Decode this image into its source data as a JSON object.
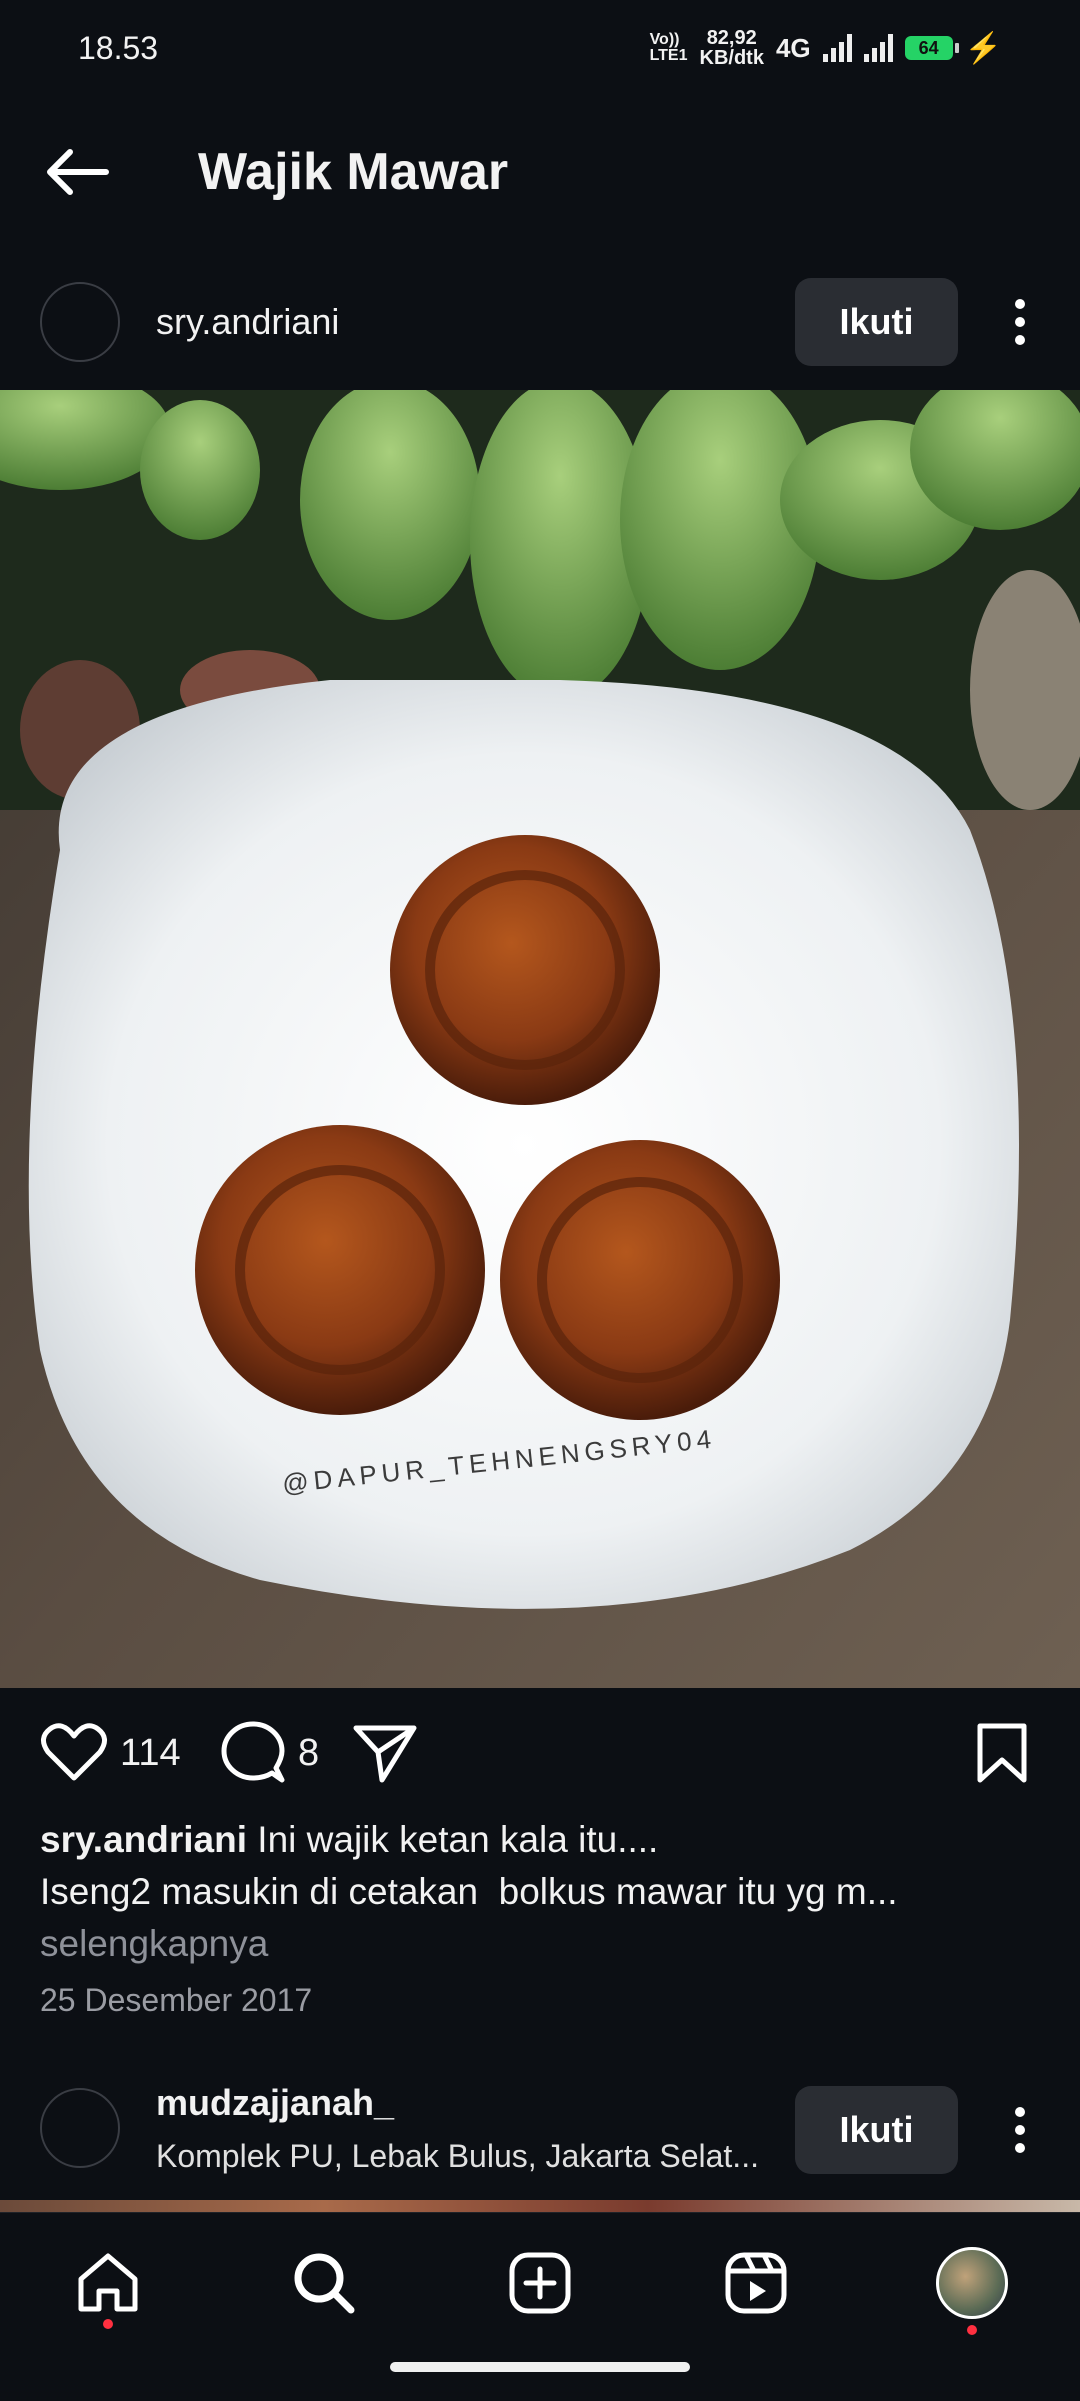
{
  "status": {
    "time": "18.53",
    "volte": "Vo))\nLTE1",
    "speed_value": "82,92",
    "speed_unit": "KB/dtk",
    "network": "4G",
    "battery": "64"
  },
  "header": {
    "title": "Wajik Mawar"
  },
  "post": {
    "username": "sry.andriani",
    "follow_label": "Ikuti",
    "watermark": "@DAPUR_TEHNENGSRY04",
    "likes": "114",
    "comments": "8",
    "caption_user": "sry.andriani",
    "caption_line1": "Ini wajik ketan kala itu....",
    "caption_line2": "Iseng2 masukin di cetakan  bolkus mawar itu yg m...",
    "more_label": "selengkapnya",
    "date": "25 Desember 2017"
  },
  "next_post": {
    "username": "mudzajjanah_",
    "location": "Komplek PU, Lebak Bulus, Jakarta Selat...",
    "follow_label": "Ikuti"
  },
  "colors": {
    "accent_red": "#ff3040",
    "button_bg": "#2a2d33",
    "background": "#0c0f14"
  }
}
